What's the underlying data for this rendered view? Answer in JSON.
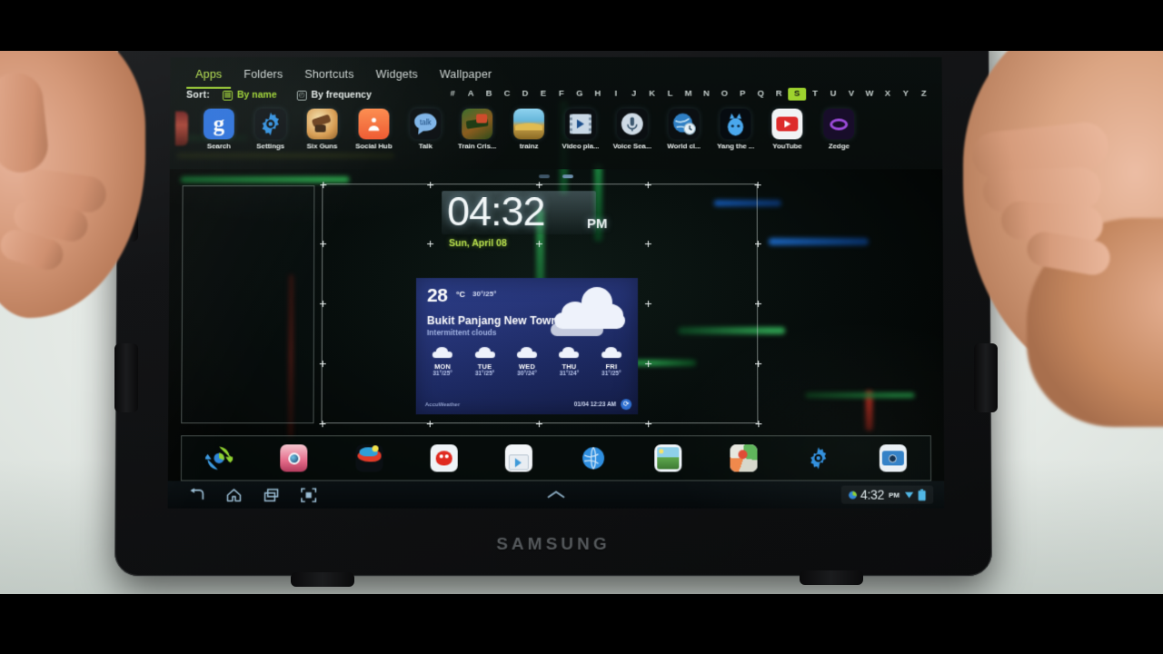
{
  "device": {
    "brand": "SAMSUNG"
  },
  "app_drawer": {
    "tabs": [
      {
        "label": "Apps",
        "active": true
      },
      {
        "label": "Folders",
        "active": false
      },
      {
        "label": "Shortcuts",
        "active": false
      },
      {
        "label": "Widgets",
        "active": false
      },
      {
        "label": "Wallpaper",
        "active": false
      }
    ],
    "sort": {
      "label": "Sort:",
      "options": [
        {
          "label": "By name",
          "icon": "grid-icon",
          "selected": true
        },
        {
          "label": "By frequency",
          "icon": "clock-icon",
          "selected": false
        }
      ]
    },
    "alpha_index": {
      "characters": [
        "#",
        "A",
        "B",
        "C",
        "D",
        "E",
        "F",
        "G",
        "H",
        "I",
        "J",
        "K",
        "L",
        "M",
        "N",
        "O",
        "P",
        "Q",
        "R",
        "S",
        "T",
        "U",
        "V",
        "W",
        "X",
        "Y",
        "Z"
      ],
      "selected": "S"
    },
    "apps": [
      {
        "label": "Search",
        "icon": "google-search-icon"
      },
      {
        "label": "Settings",
        "icon": "gear-icon"
      },
      {
        "label": "Six Guns",
        "icon": "six-guns-icon"
      },
      {
        "label": "Social Hub",
        "icon": "social-hub-icon"
      },
      {
        "label": "Talk",
        "icon": "talk-icon"
      },
      {
        "label": "Train Cris...",
        "icon": "train-crisis-icon"
      },
      {
        "label": "trainz",
        "icon": "trainz-icon"
      },
      {
        "label": "Video pla...",
        "icon": "video-player-icon"
      },
      {
        "label": "Voice Sea...",
        "icon": "microphone-icon"
      },
      {
        "label": "World cl...",
        "icon": "world-clock-icon"
      },
      {
        "label": "Yang the ...",
        "icon": "yang-the-icon"
      },
      {
        "label": "YouTube",
        "icon": "youtube-icon"
      },
      {
        "label": "Zedge",
        "icon": "zedge-icon"
      }
    ]
  },
  "home": {
    "page_indicator": {
      "total": 2,
      "current": 2
    },
    "clock_widget": {
      "time": "04:32",
      "ampm": "PM",
      "date": "Sun, April 08"
    },
    "weather_widget": {
      "temperature": "28",
      "unit": "°C",
      "high_low": "30°/25°",
      "city": "Bukit Panjang New Town",
      "condition": "Intermittent clouds",
      "source": "AccuWeather",
      "updated": "01/04 12:23 AM",
      "refresh_icon": "refresh-icon",
      "forecast": [
        {
          "day": "MON",
          "temps": "31°/25°",
          "icon": "cloud-icon"
        },
        {
          "day": "TUE",
          "temps": "31°/25°",
          "icon": "cloud-icon"
        },
        {
          "day": "WED",
          "temps": "30°/24°",
          "icon": "cloud-icon"
        },
        {
          "day": "THU",
          "temps": "31°/24°",
          "icon": "cloud-icon"
        },
        {
          "day": "FRI",
          "temps": "31°/25°",
          "icon": "cloud-icon"
        }
      ]
    },
    "dock": [
      {
        "name": "sync-icon"
      },
      {
        "name": "camera-app-icon"
      },
      {
        "name": "game-icon"
      },
      {
        "name": "angry-birds-icon"
      },
      {
        "name": "play-store-icon"
      },
      {
        "name": "browser-icon"
      },
      {
        "name": "gallery-icon"
      },
      {
        "name": "maps-icon"
      },
      {
        "name": "settings-icon"
      },
      {
        "name": "camera-icon"
      }
    ]
  },
  "system_bar": {
    "nav": [
      {
        "name": "back-button",
        "icon": "back-icon"
      },
      {
        "name": "home-button",
        "icon": "home-icon"
      },
      {
        "name": "recents-button",
        "icon": "recents-icon"
      },
      {
        "name": "screenshot-button",
        "icon": "screenshot-icon"
      }
    ],
    "handle_icon": "chevron-up-icon",
    "status": {
      "sync_icon": "sync-icon",
      "time": "4:32",
      "ampm": "PM",
      "wifi_icon": "wifi-icon",
      "battery_icon": "battery-icon"
    }
  },
  "colors": {
    "accent_green": "#9ed32e",
    "text_light": "#e8eeec",
    "weather_blue": "#2b3d86",
    "sysbar": "#05090b"
  }
}
